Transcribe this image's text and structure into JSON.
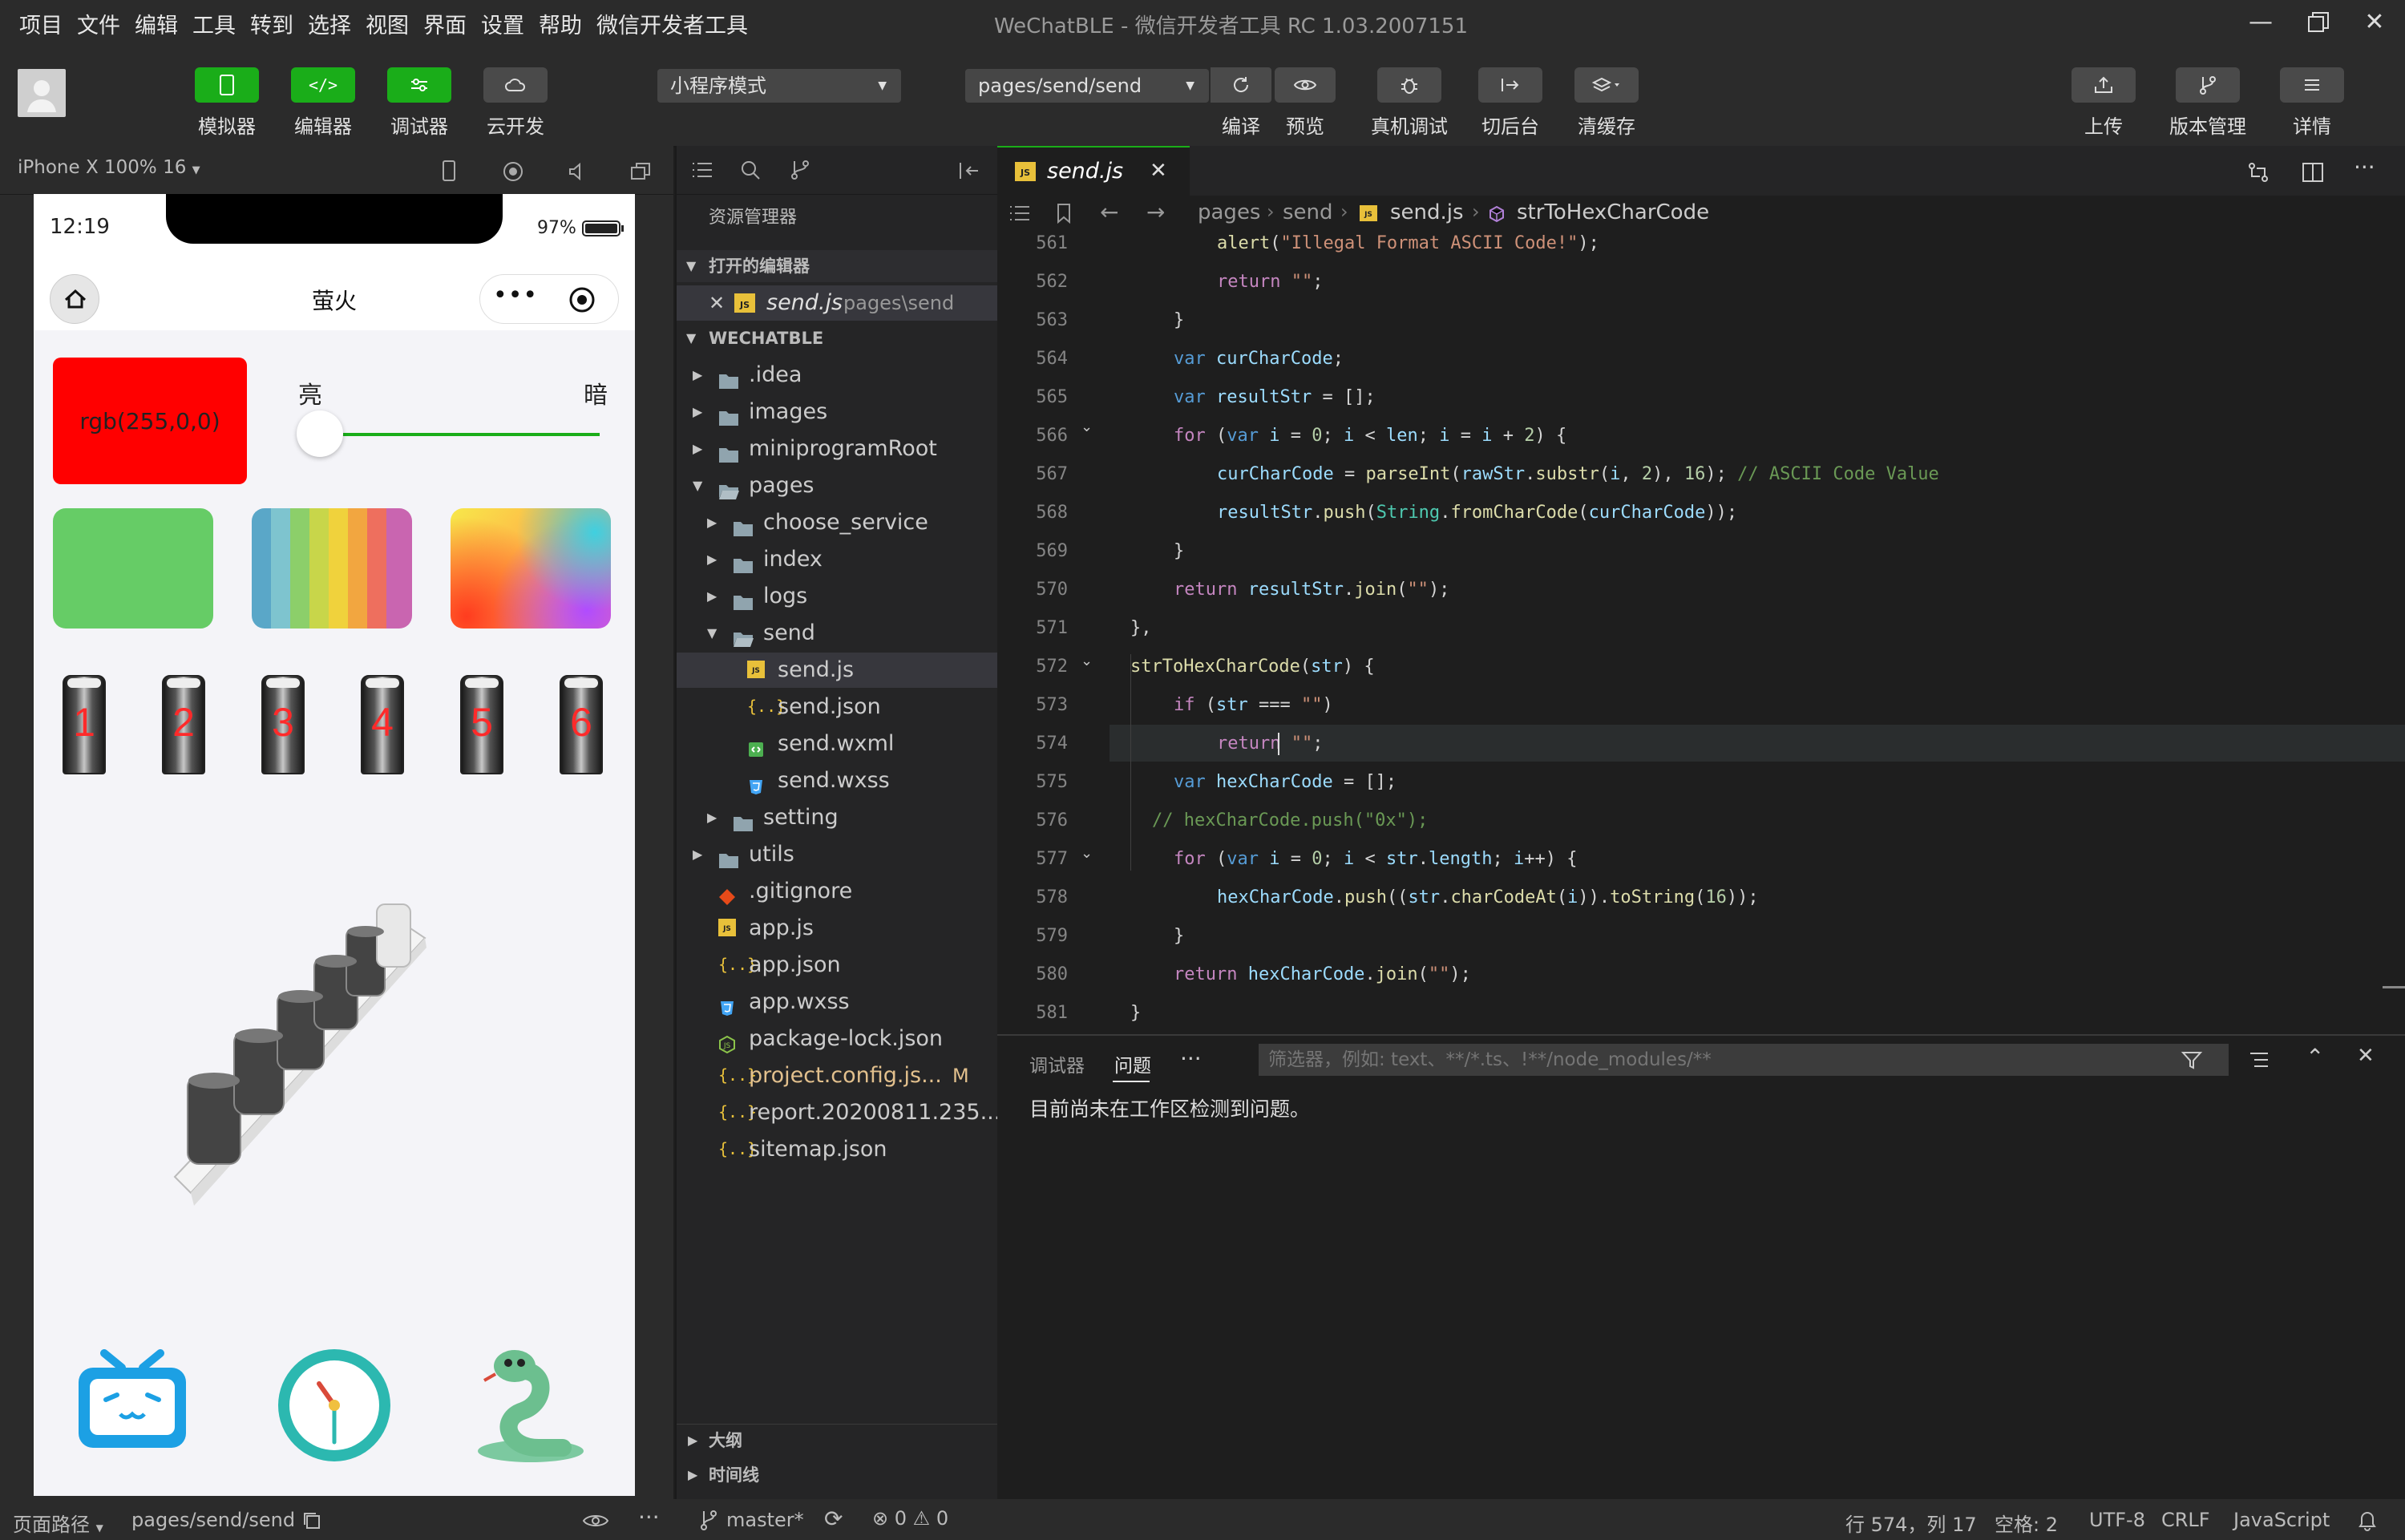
{
  "window": {
    "title": "WeChatBLE - 微信开发者工具 RC 1.03.2007151",
    "menu": [
      "项目",
      "文件",
      "编辑",
      "工具",
      "转到",
      "选择",
      "视图",
      "界面",
      "设置",
      "帮助",
      "微信开发者工具"
    ]
  },
  "toolbar": {
    "simulator": "模拟器",
    "editor": "编辑器",
    "debugger": "调试器",
    "cloud": "云开发",
    "mode_select": "小程序模式",
    "page_select": "pages/send/send",
    "compile": "编译",
    "preview": "预览",
    "device_debug": "真机调试",
    "background": "切后台",
    "clear_cache": "清缓存",
    "upload": "上传",
    "version": "版本管理",
    "details": "详情"
  },
  "simulator": {
    "device": "iPhone X 100% 16",
    "time": "12:19",
    "battery": "97%",
    "nav_title": "萤火",
    "color_label": "rgb(255,0,0)",
    "bright": "亮",
    "dark": "暗",
    "slider_value": 0,
    "tube_digits": [
      "1",
      "2",
      "3",
      "4",
      "5",
      "6"
    ]
  },
  "explorer": {
    "title": "资源管理器",
    "open_editors": "打开的编辑器",
    "open_file": "send.js",
    "open_file_path": "pages\\send",
    "project": "WECHATBLE",
    "files": [
      {
        "name": ".idea",
        "level": 1,
        "type": "folder"
      },
      {
        "name": "images",
        "level": 1,
        "type": "folder"
      },
      {
        "name": "miniprogramRoot",
        "level": 1,
        "type": "folder"
      },
      {
        "name": "pages",
        "level": 1,
        "type": "folder-open"
      },
      {
        "name": "choose_service",
        "level": 2,
        "type": "folder"
      },
      {
        "name": "index",
        "level": 2,
        "type": "folder"
      },
      {
        "name": "logs",
        "level": 2,
        "type": "folder"
      },
      {
        "name": "send",
        "level": 2,
        "type": "folder-open"
      },
      {
        "name": "send.js",
        "level": 3,
        "type": "js"
      },
      {
        "name": "send.json",
        "level": 3,
        "type": "json"
      },
      {
        "name": "send.wxml",
        "level": 3,
        "type": "wxml"
      },
      {
        "name": "send.wxss",
        "level": 3,
        "type": "wxss"
      },
      {
        "name": "setting",
        "level": 2,
        "type": "folder"
      },
      {
        "name": "utils",
        "level": 1,
        "type": "folder"
      },
      {
        "name": ".gitignore",
        "level": 1,
        "type": "git"
      },
      {
        "name": "app.js",
        "level": 1,
        "type": "js"
      },
      {
        "name": "app.json",
        "level": 1,
        "type": "json"
      },
      {
        "name": "app.wxss",
        "level": 1,
        "type": "wxss"
      },
      {
        "name": "package-lock.json",
        "level": 1,
        "type": "node"
      },
      {
        "name": "project.config.js...",
        "level": 1,
        "type": "json"
      },
      {
        "name": "report.20200811.235...",
        "level": 1,
        "type": "json"
      },
      {
        "name": "sitemap.json",
        "level": 1,
        "type": "json"
      }
    ],
    "modified_badge": "M",
    "outline": "大纲",
    "timeline": "时间线"
  },
  "editor": {
    "tab": "send.js",
    "breadcrumb": [
      "pages",
      "send",
      "send.js",
      "strToHexCharCode"
    ],
    "lines": [
      {
        "n": "561",
        "ind": 2,
        "html": "<span class=\"fn\">alert</span>(<span class=\"str\">\"Illegal Format ASCII Code!\"</span>);"
      },
      {
        "n": "562",
        "ind": 2,
        "html": "<span class=\"kw2\">return</span> <span class=\"str\">\"\"</span>;"
      },
      {
        "n": "563",
        "ind": 1,
        "html": "}"
      },
      {
        "n": "564",
        "ind": 1,
        "html": "<span class=\"kw\">var</span> <span class=\"var\">curCharCode</span>;"
      },
      {
        "n": "565",
        "ind": 1,
        "html": "<span class=\"kw\">var</span> <span class=\"var\">resultStr</span> = [];"
      },
      {
        "n": "566",
        "ind": 1,
        "html": "<span class=\"kw2\">for</span> (<span class=\"kw\">var</span> <span class=\"var\">i</span> = <span class=\"num\">0</span>; <span class=\"var\">i</span> &lt; <span class=\"var\">len</span>; <span class=\"var\">i</span> = <span class=\"var\">i</span> + <span class=\"num\">2</span>) {"
      },
      {
        "n": "567",
        "ind": 2,
        "html": "<span class=\"var\">curCharCode</span> = <span class=\"fn\">parseInt</span>(<span class=\"var\">rawStr</span>.<span class=\"fn\">substr</span>(<span class=\"var\">i</span>, <span class=\"num\">2</span>), <span class=\"num\">16</span>); <span class=\"cm\">// ASCII Code Value</span>"
      },
      {
        "n": "568",
        "ind": 2,
        "html": "<span class=\"var\">resultStr</span>.<span class=\"fn\">push</span>(<span class=\"cls\">String</span>.<span class=\"fn\">fromCharCode</span>(<span class=\"var\">curCharCode</span>));"
      },
      {
        "n": "569",
        "ind": 1,
        "html": "}"
      },
      {
        "n": "570",
        "ind": 1,
        "html": "<span class=\"kw2\">return</span> <span class=\"var\">resultStr</span>.<span class=\"fn\">join</span>(<span class=\"str\">\"\"</span>);"
      },
      {
        "n": "571",
        "ind": 0,
        "html": "},"
      },
      {
        "n": "572",
        "ind": 0,
        "html": "<span class=\"fn\">strToHexCharCode</span>(<span class=\"var\">str</span>) {"
      },
      {
        "n": "573",
        "ind": 1,
        "html": "<span class=\"kw2\">if</span> (<span class=\"var\">str</span> === <span class=\"str\">\"\"</span>)"
      },
      {
        "n": "574",
        "ind": 2,
        "html": "<span class=\"kw2\">return</span> <span class=\"str\">\"\"</span>;"
      },
      {
        "n": "575",
        "ind": 1,
        "html": "<span class=\"kw\">var</span> <span class=\"var\">hexCharCode</span> = [];"
      },
      {
        "n": "576",
        "ind": 0.5,
        "html": "<span class=\"cm\">// hexCharCode.push(\"0x\");</span>"
      },
      {
        "n": "577",
        "ind": 1,
        "html": "<span class=\"kw2\">for</span> (<span class=\"kw\">var</span> <span class=\"var\">i</span> = <span class=\"num\">0</span>; <span class=\"var\">i</span> &lt; <span class=\"var\">str</span>.<span class=\"var\">length</span>; <span class=\"var\">i</span>++) {"
      },
      {
        "n": "578",
        "ind": 2,
        "html": "<span class=\"var\">hexCharCode</span>.<span class=\"fn\">push</span>((<span class=\"var\">str</span>.<span class=\"fn\">charCodeAt</span>(<span class=\"var\">i</span>)).<span class=\"fn\">toString</span>(<span class=\"num\">16</span>));"
      },
      {
        "n": "579",
        "ind": 1,
        "html": "}"
      },
      {
        "n": "580",
        "ind": 1,
        "html": "<span class=\"kw2\">return</span> <span class=\"var\">hexCharCode</span>.<span class=\"fn\">join</span>(<span class=\"str\">\"\"</span>);"
      },
      {
        "n": "581",
        "ind": 0,
        "html": "}"
      }
    ]
  },
  "panel": {
    "tab_debug": "调试器",
    "tab_problems": "问题",
    "more": "···",
    "filter_placeholder": "筛选器，例如: text、**/*.ts、!**/node_modules/**",
    "message": "目前尚未在工作区检测到问题。"
  },
  "status": {
    "page_path_label": "页面路径",
    "page_path": "pages/send/send",
    "branch": "master*",
    "errors": "0",
    "warnings": "0",
    "position": "行 574，列 17",
    "spaces": "空格: 2",
    "encoding": "UTF-8",
    "eol": "CRLF",
    "language": "JavaScript"
  }
}
